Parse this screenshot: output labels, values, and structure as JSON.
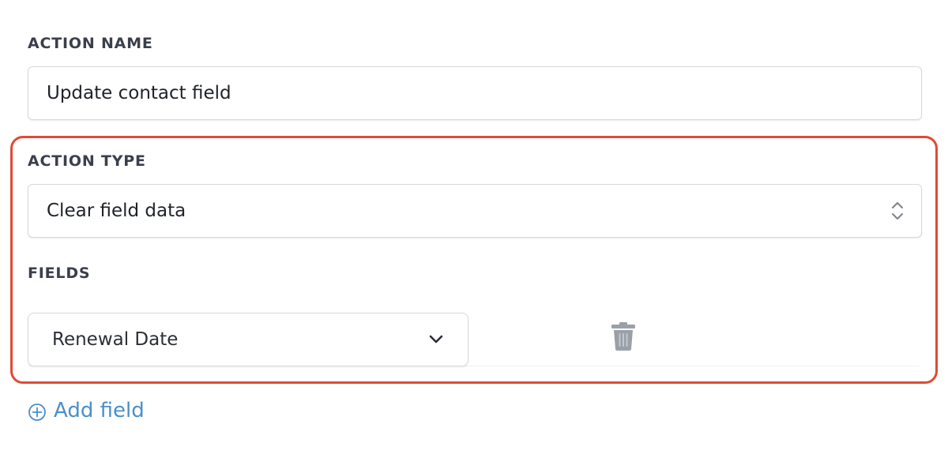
{
  "action_name": {
    "label": "ACTION NAME",
    "value": "Update contact field"
  },
  "action_type": {
    "label": "ACTION TYPE",
    "selected": "Clear field data"
  },
  "fields": {
    "label": "FIELDS",
    "items": [
      {
        "selected": "Renewal Date"
      }
    ],
    "add_label": "Add field"
  },
  "colors": {
    "highlight": "#e04a35",
    "link": "#4a8fc7",
    "trash": "#9aa0a8"
  },
  "icons": {
    "select": "updown-chevron-icon",
    "dropdown": "chevron-down-icon",
    "delete": "trash-icon",
    "add": "plus-circle-icon"
  }
}
